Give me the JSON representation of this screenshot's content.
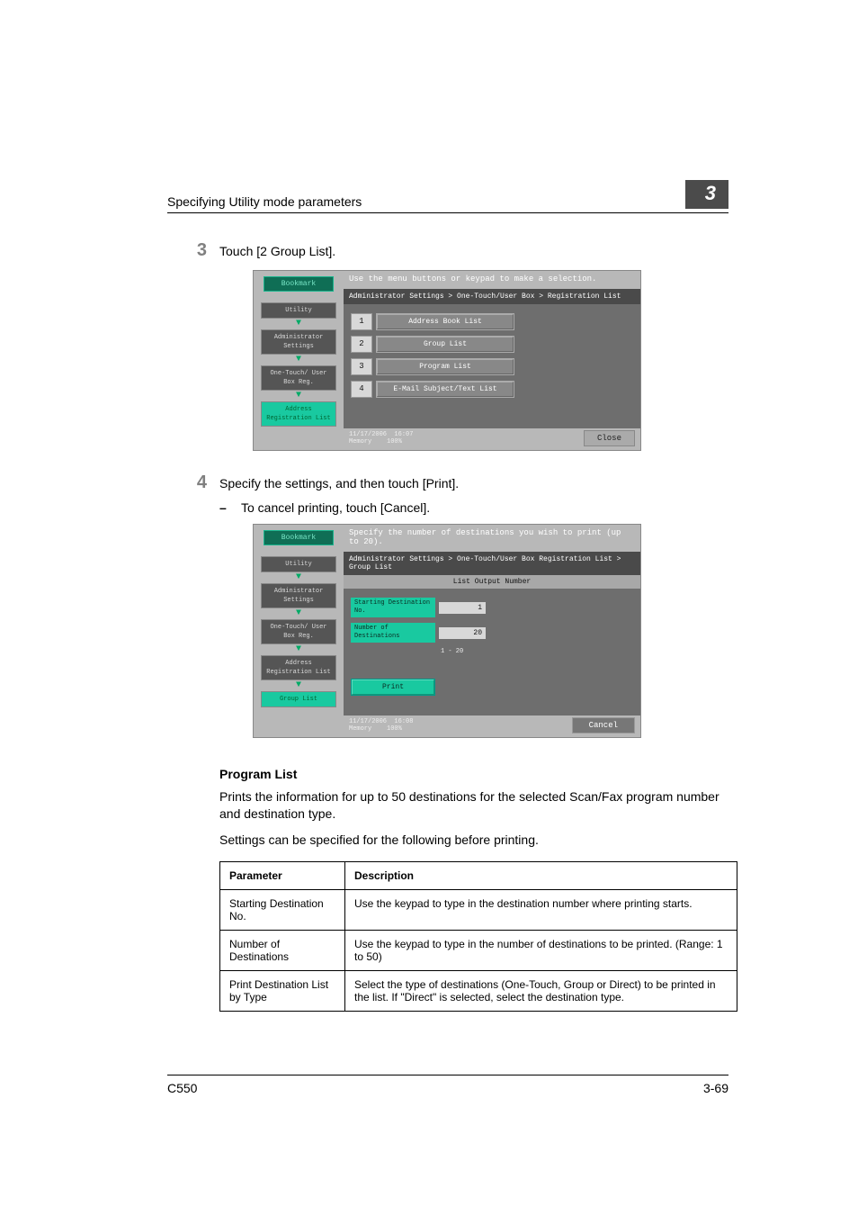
{
  "header": {
    "title": "Specifying Utility mode parameters",
    "chapter": "3"
  },
  "steps": {
    "s3": {
      "num": "3",
      "text": "Touch [2 Group List]."
    },
    "s4": {
      "num": "4",
      "text": "Specify the settings, and then touch [Print].",
      "bullet": "To cancel printing, touch [Cancel]."
    }
  },
  "screenshot1": {
    "msg": "Use the menu buttons or keypad to make a selection.",
    "breadcrumb": "Administrator Settings > One-Touch/User Box > Registration List",
    "bookmark": "Bookmark",
    "nav": {
      "utility": "Utility",
      "admin": "Administrator Settings",
      "onetouch": "One-Touch/ User Box Reg.",
      "reglist": "Address Registration List"
    },
    "items": [
      {
        "n": "1",
        "label": "Address Book List"
      },
      {
        "n": "2",
        "label": "Group List"
      },
      {
        "n": "3",
        "label": "Program List"
      },
      {
        "n": "4",
        "label": "E-Mail Subject/Text List"
      }
    ],
    "status": {
      "date": "11/17/2006",
      "time": "16:07",
      "memLabel": "Memory",
      "mem": "100%"
    },
    "close": "Close"
  },
  "screenshot2": {
    "msg": "Specify the number of destinations you wish to print (up to 20).",
    "breadcrumb": "Administrator Settings > One-Touch/User Box Registration List > Group List",
    "sub": "List Output Number",
    "bookmark": "Bookmark",
    "nav": {
      "utility": "Utility",
      "admin": "Administrator Settings",
      "onetouch": "One-Touch/ User Box Reg.",
      "reglist": "Address Registration List",
      "group": "Group List"
    },
    "fields": {
      "start": {
        "label": "Starting Destination No.",
        "val": "1"
      },
      "num": {
        "label": "Number of Destinations",
        "val": "20",
        "range": "1  -  20"
      }
    },
    "print": "Print",
    "status": {
      "date": "11/17/2006",
      "time": "16:08",
      "memLabel": "Memory",
      "mem": "100%"
    },
    "cancel": "Cancel"
  },
  "programList": {
    "heading": "Program List",
    "p1": "Prints the information for up to 50 destinations for the selected Scan/Fax program number and destination type.",
    "p2": "Settings can be specified for the following before printing."
  },
  "table": {
    "h1": "Parameter",
    "h2": "Description",
    "rows": [
      {
        "p": "Starting Destination No.",
        "d": "Use the keypad to type in the destination number where printing starts."
      },
      {
        "p": "Number of Destinations",
        "d": "Use the keypad to type in the number of destinations to be printed. (Range: 1 to 50)"
      },
      {
        "p": "Print Destination List by Type",
        "d": "Select the type of destinations (One-Touch, Group or Direct) to be printed in the list. If \"Direct\" is selected, select the destination type."
      }
    ]
  },
  "footer": {
    "left": "C550",
    "right": "3-69"
  }
}
